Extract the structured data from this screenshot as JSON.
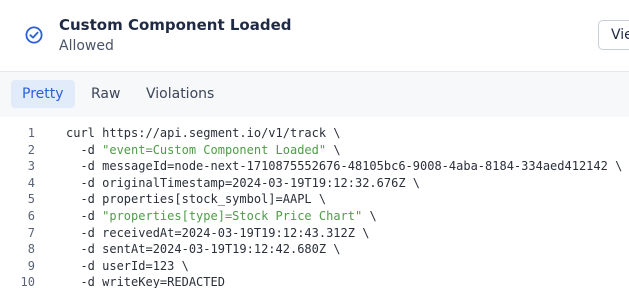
{
  "header": {
    "title": "Custom Component Loaded",
    "subtitle": "Allowed",
    "view_button_label": "View"
  },
  "tabs": [
    {
      "label": "Pretty",
      "active": true
    },
    {
      "label": "Raw",
      "active": false
    },
    {
      "label": "Violations",
      "active": false
    }
  ],
  "code_lines": [
    {
      "num": "1",
      "parts": [
        {
          "text": "curl https://api.segment.io/v1/track \\",
          "kind": "plain"
        }
      ]
    },
    {
      "num": "2",
      "parts": [
        {
          "text": "  -d ",
          "kind": "plain"
        },
        {
          "text": "\"event=Custom Component Loaded\"",
          "kind": "string"
        },
        {
          "text": " \\",
          "kind": "plain"
        }
      ]
    },
    {
      "num": "3",
      "parts": [
        {
          "text": "  -d messageId=node-next-1710875552676-48105bc6-9008-4aba-8184-334aed412142 \\",
          "kind": "plain"
        }
      ]
    },
    {
      "num": "4",
      "parts": [
        {
          "text": "  -d originalTimestamp=2024-03-19T19:12:32.676Z \\",
          "kind": "plain"
        }
      ]
    },
    {
      "num": "5",
      "parts": [
        {
          "text": "  -d properties[stock_symbol]=AAPL \\",
          "kind": "plain"
        }
      ]
    },
    {
      "num": "6",
      "parts": [
        {
          "text": "  -d ",
          "kind": "plain"
        },
        {
          "text": "\"properties[type]=Stock Price Chart\"",
          "kind": "string"
        },
        {
          "text": " \\",
          "kind": "plain"
        }
      ]
    },
    {
      "num": "7",
      "parts": [
        {
          "text": "  -d receivedAt=2024-03-19T19:12:43.312Z \\",
          "kind": "plain"
        }
      ]
    },
    {
      "num": "8",
      "parts": [
        {
          "text": "  -d sentAt=2024-03-19T19:12:42.680Z \\",
          "kind": "plain"
        }
      ]
    },
    {
      "num": "9",
      "parts": [
        {
          "text": "  -d userId=123 \\",
          "kind": "plain"
        }
      ]
    },
    {
      "num": "10",
      "parts": [
        {
          "text": "  -d writeKey=REDACTED",
          "kind": "plain"
        }
      ]
    }
  ],
  "colors": {
    "accent": "#2b5fd9",
    "string": "#4f9c48",
    "check_icon": "#2b5fd9"
  },
  "icons": {
    "status": "check-circle-icon"
  }
}
